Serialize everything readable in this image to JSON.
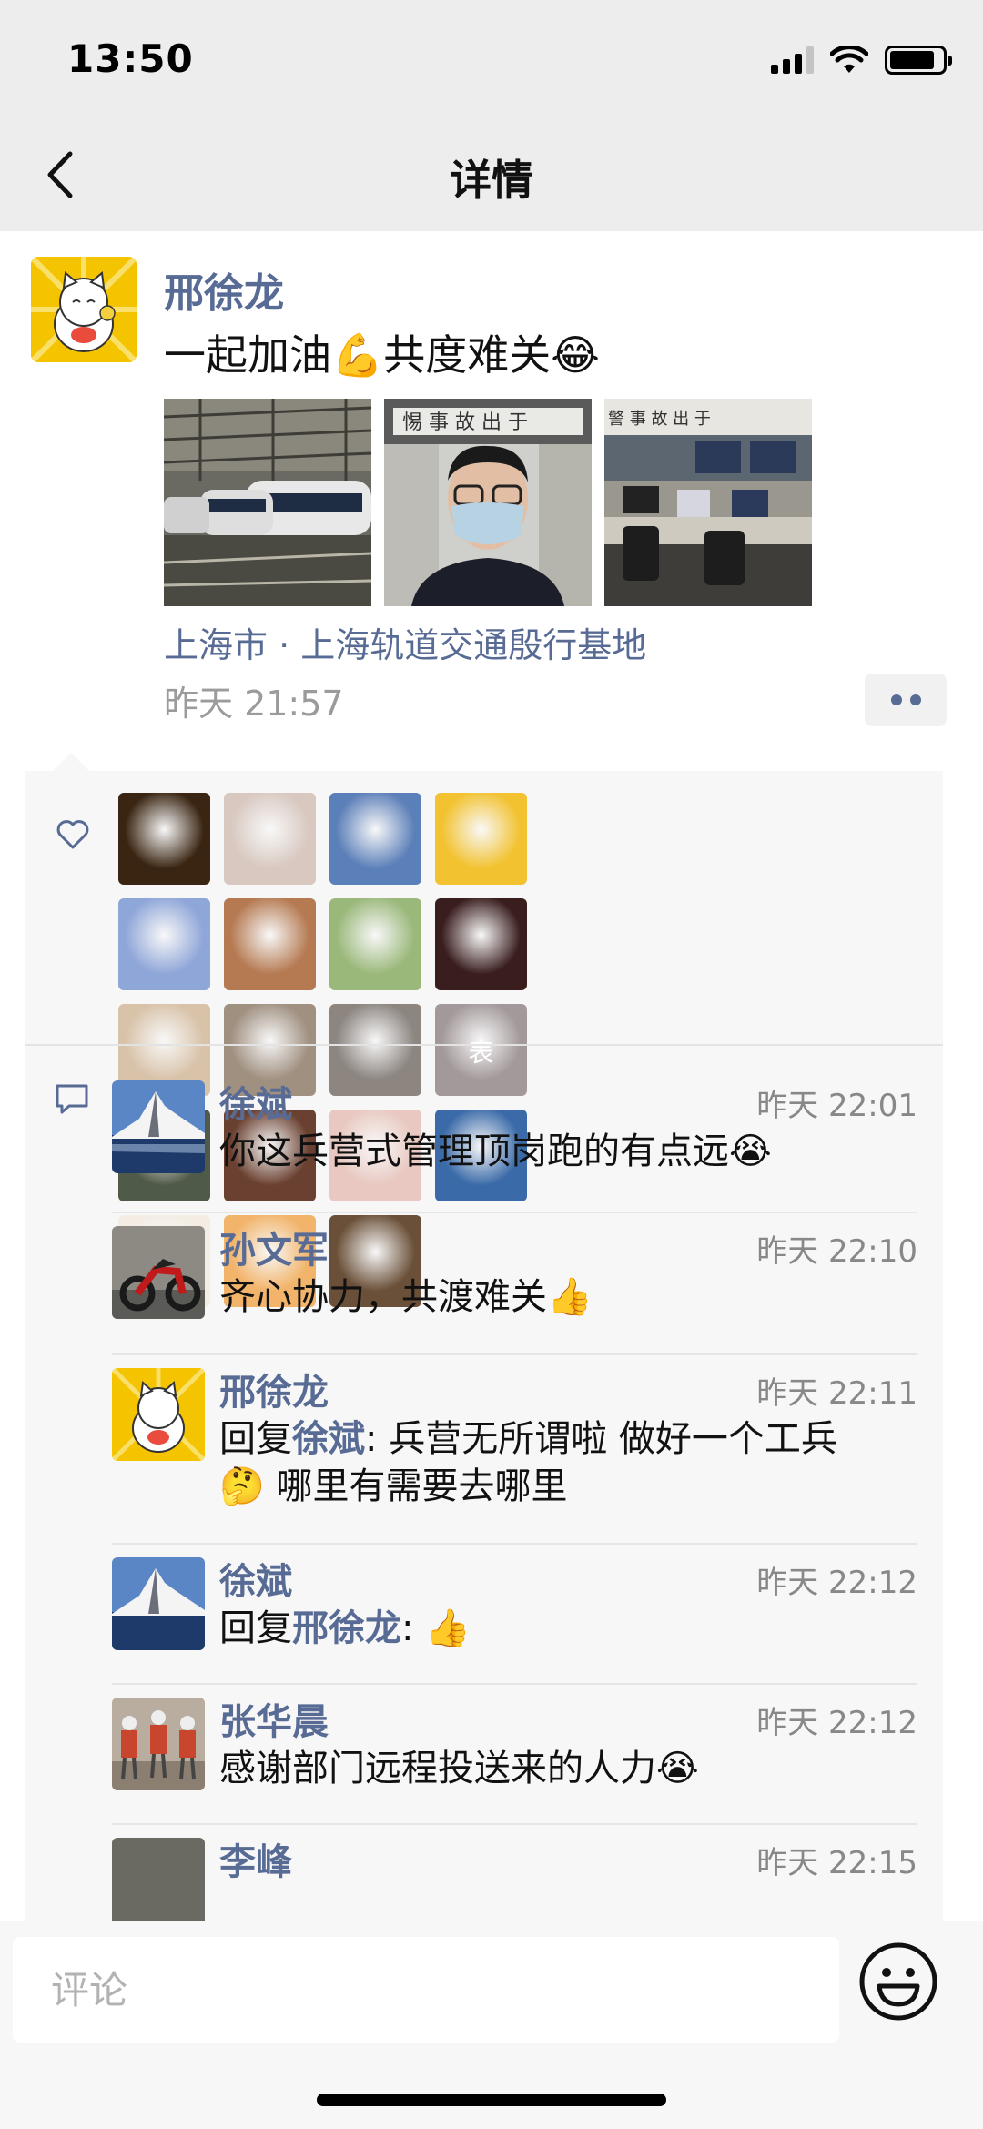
{
  "status": {
    "time": "13:50",
    "signal_icon": "cellular-signal-icon",
    "wifi_icon": "wifi-icon",
    "battery_icon": "battery-icon"
  },
  "nav": {
    "title": "详情",
    "back_icon": "chevron-left-icon"
  },
  "post": {
    "author": "邢徐龙",
    "text": "一起加油💪共度难关😂",
    "location": "上海市 · 上海轨道交通殷行基地",
    "time": "昨天 21:57",
    "image_count": 3,
    "more_icon": "more-dots-icon"
  },
  "likes": {
    "icon": "heart-icon",
    "avatars": [
      {
        "name": "tiger",
        "color": "#3a2512"
      },
      {
        "name": "wedding-couple",
        "color": "#d8c8c0"
      },
      {
        "name": "matterhorn",
        "color": "#5b7fb8"
      },
      {
        "name": "yellow-baby",
        "color": "#f2c230"
      },
      {
        "name": "sleeping-cartoon",
        "color": "#8fa6d8"
      },
      {
        "name": "jerry-mouse",
        "color": "#b57a52"
      },
      {
        "name": "cabbage",
        "color": "#9ab87a"
      },
      {
        "name": "dark-corridor",
        "color": "#3a1e1e"
      },
      {
        "name": "girl-with-flowers",
        "color": "#d8c2a8"
      },
      {
        "name": "robot-figures",
        "color": "#a09080"
      },
      {
        "name": "gray-animal",
        "color": "#8c8580"
      },
      {
        "name": "woman-portrait",
        "color": "#a3999a",
        "label": "表"
      },
      {
        "name": "man-outdoors",
        "color": "#4f5a48"
      },
      {
        "name": "dog",
        "color": "#6a4030"
      },
      {
        "name": "child-pink",
        "color": "#e8c8c0"
      },
      {
        "name": "seascape",
        "color": "#3a6aa8"
      },
      {
        "name": "mushroom",
        "color": "#f3ede4"
      },
      {
        "name": "cartoon-cat",
        "color": "#f2b46a"
      },
      {
        "name": "danbo-box",
        "color": "#6a5038"
      }
    ]
  },
  "comments": [
    {
      "name": "徐斌",
      "time": "昨天 22:01",
      "text": "你这兵营式管理顶岗跑的有点远",
      "emoji": "😭",
      "avatar": "matterhorn"
    },
    {
      "name": "孙文军",
      "time": "昨天 22:10",
      "text": "齐心协力，共渡难关",
      "emoji": "👍",
      "avatar": "motorcycle"
    },
    {
      "name": "邢徐龙",
      "time": "昨天 22:11",
      "reply_prefix": "回复",
      "reply_to": "徐斌",
      "text": ": 兵营无所谓啦 做好一个工兵",
      "text2": "哪里有需要去哪里",
      "emoji": "🤔",
      "avatar": "lucky-cat"
    },
    {
      "name": "徐斌",
      "time": "昨天 22:12",
      "reply_prefix": "回复",
      "reply_to": "邢徐龙",
      "text": ":",
      "emoji": "👍",
      "avatar": "matterhorn"
    },
    {
      "name": "张华晨",
      "time": "昨天 22:12",
      "text": "感谢部门远程投送来的人力",
      "emoji": "😭",
      "avatar": "robot-figures"
    },
    {
      "name": "李峰",
      "time": "昨天 22:15",
      "text": "",
      "avatar": "partial"
    }
  ],
  "input": {
    "placeholder": "评论",
    "emoji_icon": "smiley-face-icon"
  }
}
